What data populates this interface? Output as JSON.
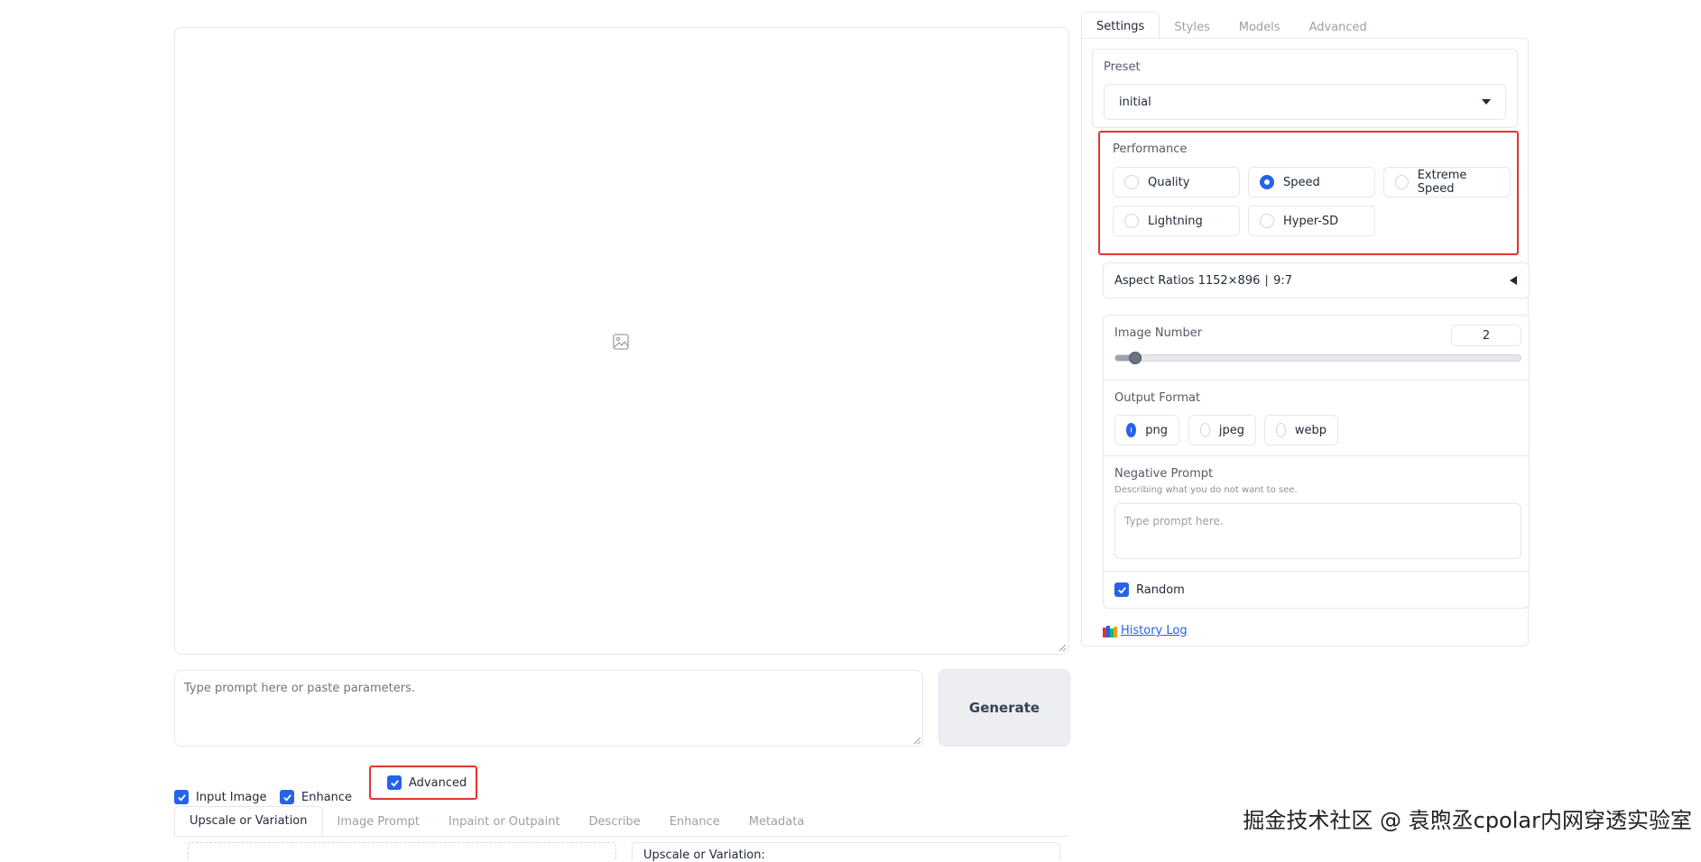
{
  "prompt": {
    "placeholder": "Type prompt here or paste parameters."
  },
  "generate_label": "Generate",
  "checkboxes": [
    {
      "label": "Input Image",
      "checked": true
    },
    {
      "label": "Enhance",
      "checked": true
    },
    {
      "label": "Advanced",
      "checked": true
    }
  ],
  "bottom_tabs": [
    "Upscale or Variation",
    "Image Prompt",
    "Inpaint or Outpaint",
    "Describe",
    "Enhance",
    "Metadata"
  ],
  "bottom_panel_label": "Upscale or Variation:",
  "right_tabs": [
    "Settings",
    "Styles",
    "Models",
    "Advanced"
  ],
  "preset": {
    "label": "Preset",
    "value": "initial"
  },
  "performance": {
    "label": "Performance",
    "options": [
      "Quality",
      "Speed",
      "Extreme Speed",
      "Lightning",
      "Hyper-SD"
    ],
    "selected": "Speed"
  },
  "aspect_ratios": {
    "text": "Aspect Ratios 1152×896 ∣ 9:7"
  },
  "image_number": {
    "label": "Image Number",
    "value": "2",
    "slider_fraction": 0.03
  },
  "output_format": {
    "label": "Output Format",
    "options": [
      "png",
      "jpeg",
      "webp"
    ],
    "selected": "png"
  },
  "negative_prompt": {
    "label": "Negative Prompt",
    "description": "Describing what you do not want to see.",
    "placeholder": "Type prompt here."
  },
  "random": {
    "label": "Random",
    "checked": true
  },
  "history_log": "History Log",
  "watermark": "掘金技术社区 @ 袁煦丞cpolar内网穿透实验室",
  "colors": {
    "accent": "#2563eb",
    "highlight": "#e3342f"
  }
}
